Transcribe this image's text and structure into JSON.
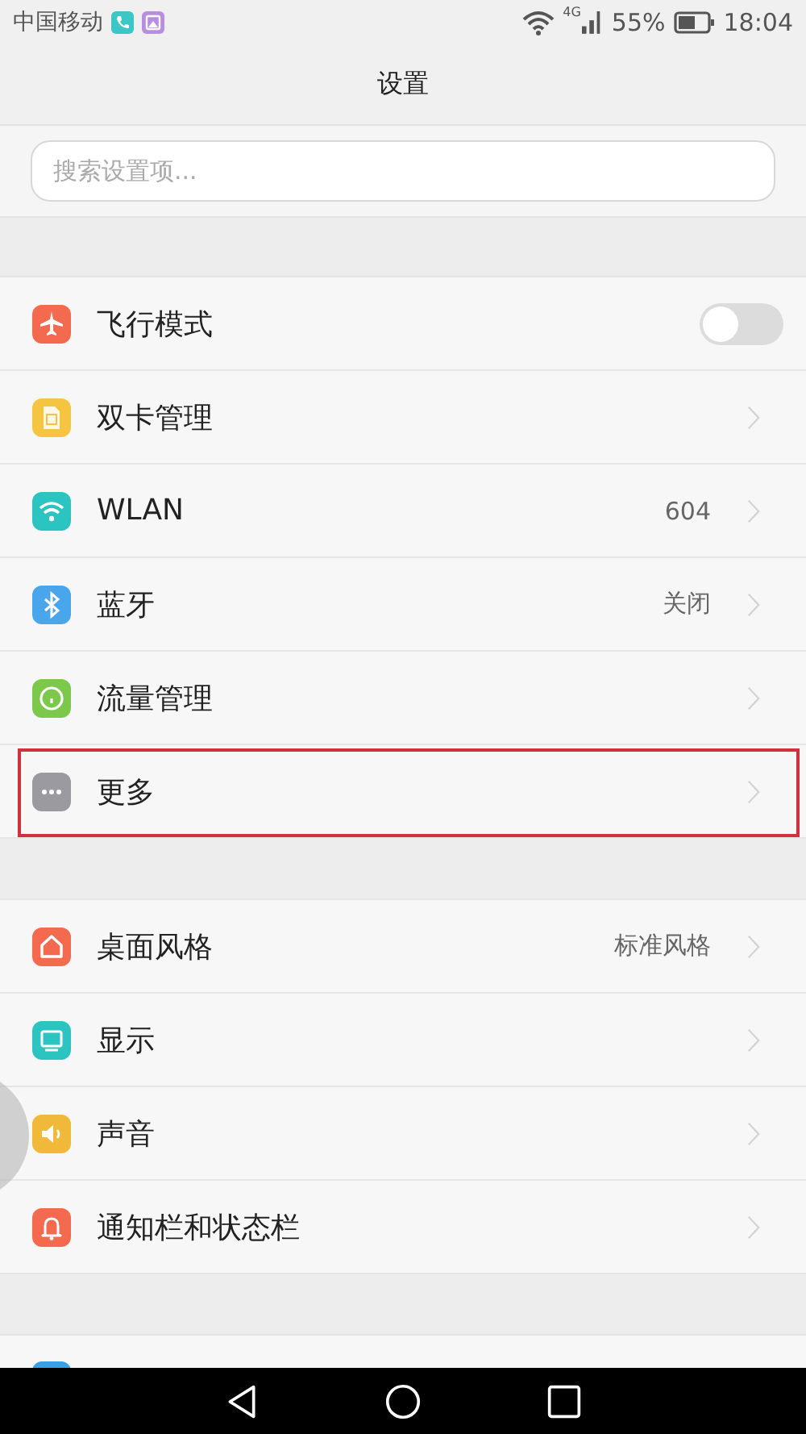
{
  "status_bar": {
    "carrier": "中国移动",
    "network": "4G",
    "battery": "55%",
    "time": "18:04"
  },
  "title": "设置",
  "search": {
    "placeholder": "搜索设置项..."
  },
  "groups": [
    {
      "items": [
        {
          "kind": "toggle",
          "label": "飞行模式",
          "color": "#f36a4f",
          "on": false,
          "highlighted": false
        },
        {
          "kind": "link",
          "label": "双卡管理",
          "color": "#f5c542",
          "highlighted": false
        },
        {
          "kind": "link",
          "label": "WLAN",
          "value": "604",
          "color": "#2cc4c0",
          "highlighted": false
        },
        {
          "kind": "link",
          "label": "蓝牙",
          "value": "关闭",
          "color": "#4aa6ec",
          "highlighted": false
        },
        {
          "kind": "link",
          "label": "流量管理",
          "color": "#7cc84a",
          "highlighted": false
        },
        {
          "kind": "link",
          "label": "更多",
          "color": "#9a9aa0",
          "highlighted": true
        }
      ]
    },
    {
      "items": [
        {
          "kind": "link",
          "label": "桌面风格",
          "value": "标准风格",
          "color": "#f36a4f",
          "highlighted": false
        },
        {
          "kind": "link",
          "label": "显示",
          "color": "#2cc4c0",
          "highlighted": false
        },
        {
          "kind": "link",
          "label": "声音",
          "color": "#f0b93a",
          "highlighted": false
        },
        {
          "kind": "link",
          "label": "通知栏和状态栏",
          "color": "#f36a4f",
          "highlighted": false
        }
      ]
    },
    {
      "items": [
        {
          "kind": "partial",
          "color": "#3aa0e6"
        }
      ]
    }
  ]
}
